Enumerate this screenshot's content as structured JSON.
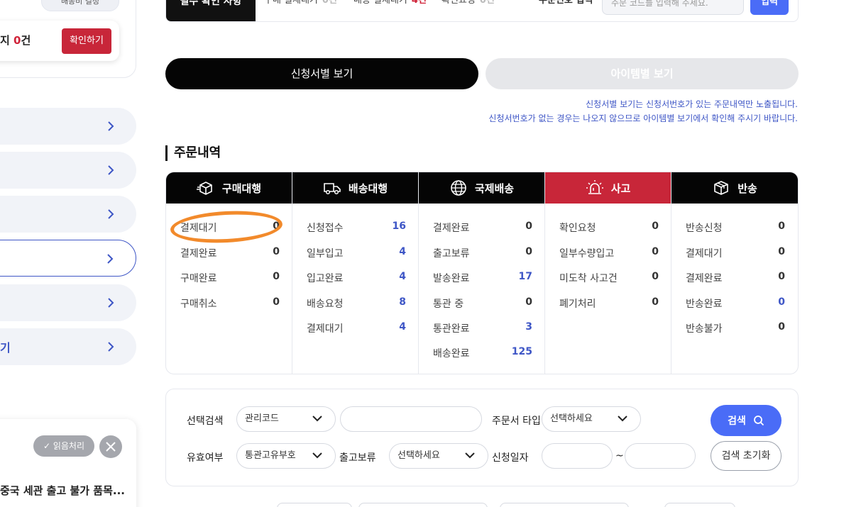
{
  "sidebar": {
    "top_pill": "배송비 결정",
    "alert": {
      "prefix": "지 ",
      "count": "0",
      "suffix": "건",
      "button": "확인하기"
    },
    "menu_last_label": "기",
    "notice": {
      "read_button": "읽음처리",
      "title": "중국 세관 출고 불가 품목..."
    }
  },
  "topbar": {
    "title": "필수 확인 사항",
    "items": [
      {
        "label": "구매 결제대기",
        "count": "0건",
        "highlight": false
      },
      {
        "label": "배송 결제대기",
        "count": "4건",
        "highlight": true
      },
      {
        "label": "확인요청",
        "count": "0건",
        "highlight": false
      }
    ],
    "order_no_label": "주문번호 입력",
    "order_no_placeholder": "주문 코드를 입력해 주세요.",
    "submit_label": "입력"
  },
  "view_toggle": {
    "by_application": "신청서별 보기",
    "by_item": "아이템별 보기"
  },
  "notes": [
    "신청서별 보기는 신청서번호가 있는 주문내역만 노출됩니다.",
    "신청서번호가 없는 경우는 나오지 않으므로 아이템별 보기에서 확인해 주시기 바랍니다."
  ],
  "section_title": "주문내역",
  "status_columns": [
    {
      "title": "구매대행",
      "icon": "box-icon",
      "rows": [
        {
          "label": "결제대기",
          "value": "0",
          "blue": false
        },
        {
          "label": "결제완료",
          "value": "0",
          "blue": false
        },
        {
          "label": "구매완료",
          "value": "0",
          "blue": false
        },
        {
          "label": "구매취소",
          "value": "0",
          "blue": false
        }
      ]
    },
    {
      "title": "배송대행",
      "icon": "truck-icon",
      "rows": [
        {
          "label": "신청접수",
          "value": "16",
          "blue": true
        },
        {
          "label": "일부입고",
          "value": "4",
          "blue": true
        },
        {
          "label": "입고완료",
          "value": "4",
          "blue": true
        },
        {
          "label": "배송요청",
          "value": "8",
          "blue": true
        },
        {
          "label": "결제대기",
          "value": "4",
          "blue": true
        }
      ]
    },
    {
      "title": "국제배송",
      "icon": "globe-icon",
      "rows": [
        {
          "label": "결제완료",
          "value": "0",
          "blue": false
        },
        {
          "label": "출고보류",
          "value": "0",
          "blue": false
        },
        {
          "label": "발송완료",
          "value": "17",
          "blue": true
        },
        {
          "label": "통관 중",
          "value": "0",
          "blue": false
        },
        {
          "label": "통관완료",
          "value": "3",
          "blue": true
        },
        {
          "label": "배송완료",
          "value": "125",
          "blue": true
        }
      ]
    },
    {
      "title": "사고",
      "icon": "siren-icon",
      "rows": [
        {
          "label": "확인요청",
          "value": "0",
          "blue": false
        },
        {
          "label": "일부수량입고",
          "value": "0",
          "blue": false
        },
        {
          "label": "미도착 사고건",
          "value": "0",
          "blue": false
        },
        {
          "label": "폐기처리",
          "value": "0",
          "blue": false
        }
      ]
    },
    {
      "title": "반송",
      "icon": "return-box-icon",
      "rows": [
        {
          "label": "반송신청",
          "value": "0",
          "blue": false
        },
        {
          "label": "결제대기",
          "value": "0",
          "blue": false
        },
        {
          "label": "결제완료",
          "value": "0",
          "blue": false
        },
        {
          "label": "반송완료",
          "value": "0",
          "blue": true
        },
        {
          "label": "반송불가",
          "value": "0",
          "blue": false
        }
      ]
    }
  ],
  "search": {
    "select_search_label": "선택검색",
    "select_search_value": "관리코드",
    "order_type_label": "주문서 타입",
    "order_type_value": "선택하세요",
    "valid_label": "유효여부",
    "valid_value": "통관고유부호",
    "hold_label": "출고보류",
    "hold_value": "선택하세요",
    "date_label": "신청일자",
    "date_sep": "~",
    "search_button": "검색",
    "reset_button": "검색 초기화"
  },
  "colors": {
    "accent_blue": "#3e56c6",
    "button_blue": "#4a6cf7",
    "alert_red": "#c82639",
    "annotation_orange": "#f28a2b"
  }
}
